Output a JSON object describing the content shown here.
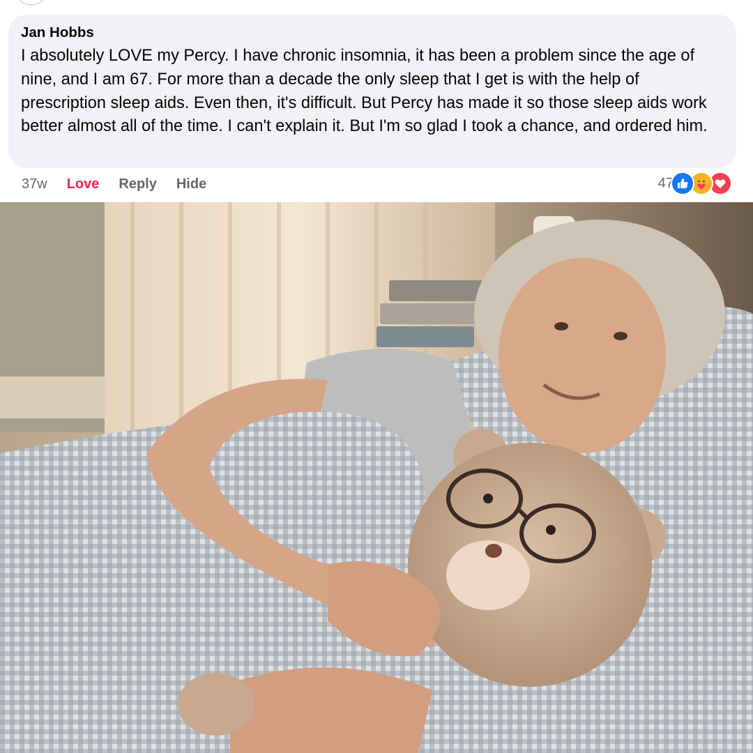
{
  "comment": {
    "author": "Jan Hobbs",
    "text": "I absolutely LOVE my Percy. I have chronic insomnia, it has been a problem since the age of nine, and I am 67. For more than a decade the only sleep that I get is with the help of prescription sleep aids. Even then, it's difficult. But Percy has made it so those sleep aids work better almost all of the time. I can't explain it. But I'm so glad I took a chance, and ordered him."
  },
  "actions": {
    "timestamp": "37w",
    "love": "Love",
    "reply": "Reply",
    "hide": "Hide"
  },
  "reactions": {
    "count": "47",
    "icons": [
      "like-icon",
      "care-icon",
      "heart-icon"
    ],
    "colors": {
      "like": "#1877f2",
      "care": "#f7b125",
      "love": "#f33e58",
      "love_link": "#e4264b"
    }
  },
  "photo": {
    "subject": "photo-older-woman-with-teddy-bear"
  }
}
